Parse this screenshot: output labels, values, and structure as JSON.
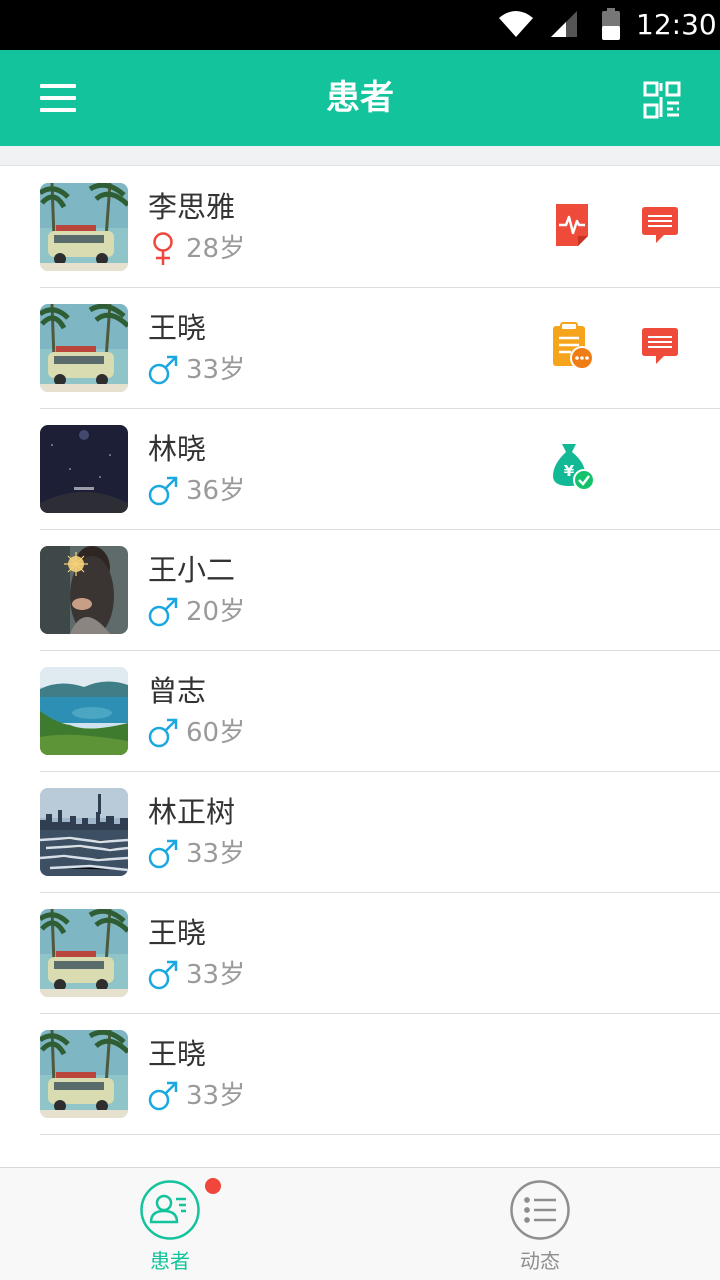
{
  "status_bar": {
    "time": "12:30"
  },
  "header": {
    "title": "患者"
  },
  "patients": [
    {
      "name": "李思雅",
      "gender": "female",
      "age": "28岁",
      "avatar": "van-palm",
      "actions": [
        "ecg-report-icon",
        "message-icon"
      ]
    },
    {
      "name": "王晓",
      "gender": "male",
      "age": "33岁",
      "avatar": "van-palm",
      "actions": [
        "clipboard-pending-icon",
        "message-icon"
      ]
    },
    {
      "name": "林晓",
      "gender": "male",
      "age": "36岁",
      "avatar": "night-sky",
      "actions": [
        "money-bag-paid-icon"
      ]
    },
    {
      "name": "王小二",
      "gender": "male",
      "age": "20岁",
      "avatar": "sparkler-girl",
      "actions": []
    },
    {
      "name": "曾志",
      "gender": "male",
      "age": "60岁",
      "avatar": "coast-bay",
      "actions": []
    },
    {
      "name": "林正树",
      "gender": "male",
      "age": "33岁",
      "avatar": "city-skyline",
      "actions": []
    },
    {
      "name": "王晓",
      "gender": "male",
      "age": "33岁",
      "avatar": "van-palm",
      "actions": []
    },
    {
      "name": "王晓",
      "gender": "male",
      "age": "33岁",
      "avatar": "van-palm",
      "actions": []
    }
  ],
  "bottom_nav": {
    "tabs": [
      {
        "label": "患者",
        "icon": "patient-card-icon",
        "active": true,
        "badge": true
      },
      {
        "label": "动态",
        "icon": "list-icon",
        "active": false,
        "badge": false
      }
    ]
  },
  "colors": {
    "primary": "#13c39b",
    "female": "#f0463b",
    "male": "#1ba7e0",
    "alert_red": "#f0463b",
    "orange": "#f7a41d"
  }
}
